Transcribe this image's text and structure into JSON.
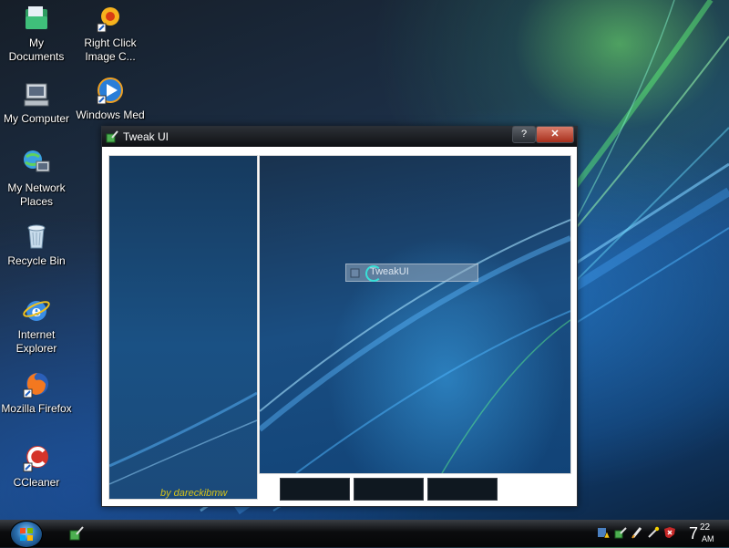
{
  "desktop": {
    "icons": [
      {
        "label": "My Documents",
        "icon": "folder-documents-icon"
      },
      {
        "label": "Right Click Image C...",
        "icon": "right-click-image-shortcut-icon"
      },
      {
        "label": "My Computer",
        "icon": "computer-icon"
      },
      {
        "label": "Windows Med",
        "icon": "windows-media-player-icon"
      },
      {
        "label": "My Network Places",
        "icon": "network-places-icon"
      },
      {
        "label": "Recycle Bin",
        "icon": "recycle-bin-icon"
      },
      {
        "label": "Internet Explorer",
        "icon": "internet-explorer-icon"
      },
      {
        "label": "Mozilla Firefox",
        "icon": "firefox-icon"
      },
      {
        "label": "CCleaner",
        "icon": "ccleaner-icon"
      }
    ]
  },
  "window": {
    "title": "Tweak UI",
    "help_label": "?",
    "close_label": "✕",
    "credit": "by dareckibmw",
    "splash_text": "TweakUI"
  },
  "taskbar": {
    "clock_hour": "7",
    "clock_minutes": "22",
    "clock_ampm": "AM"
  },
  "colors": {
    "accent_close": "#c4442e",
    "credit_text": "#d6c21a"
  }
}
